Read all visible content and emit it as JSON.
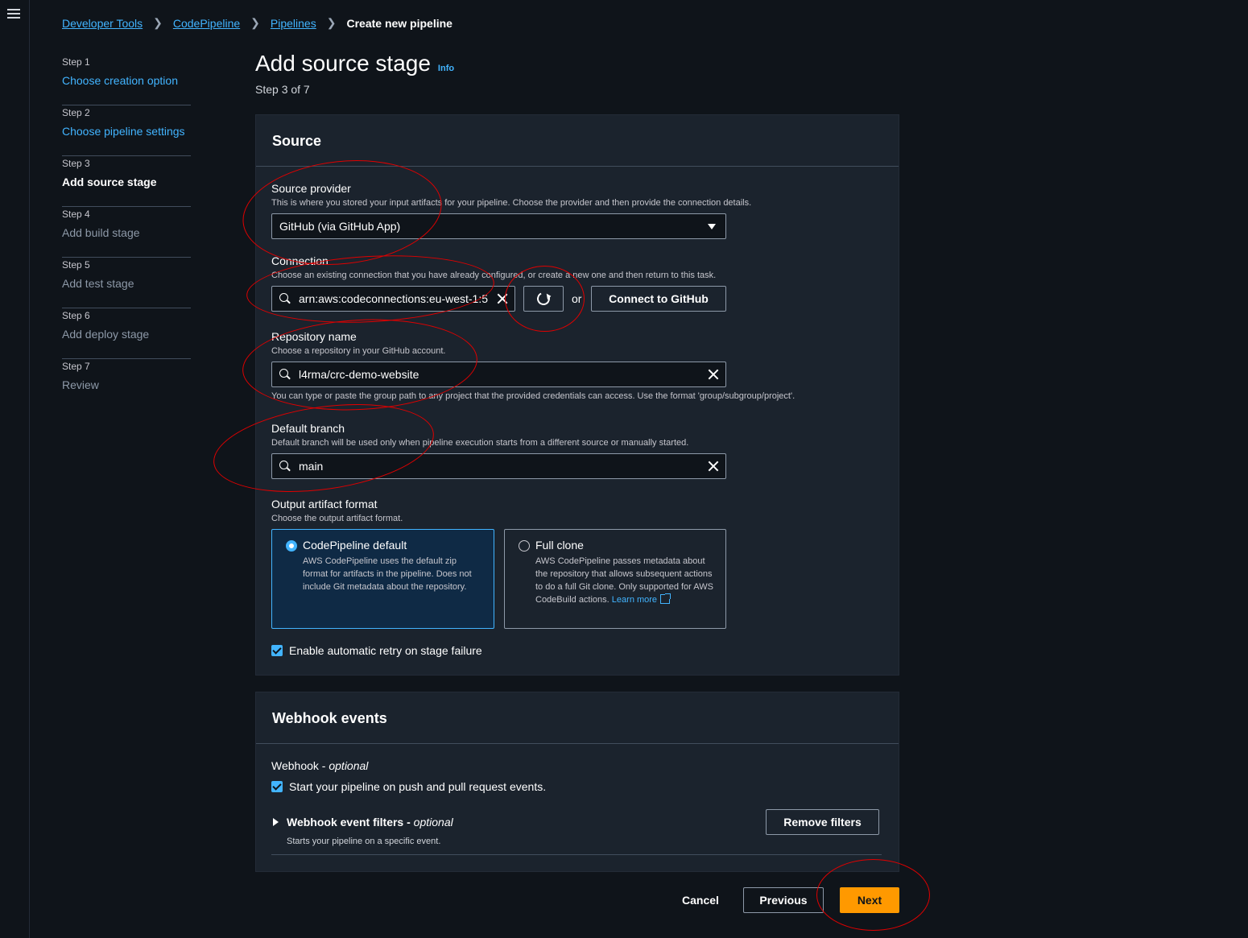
{
  "breadcrumbs": [
    "Developer Tools",
    "CodePipeline",
    "Pipelines"
  ],
  "breadcrumb_current": "Create new pipeline",
  "steps": [
    {
      "num": "Step 1",
      "title": "Choose creation option"
    },
    {
      "num": "Step 2",
      "title": "Choose pipeline settings"
    },
    {
      "num": "Step 3",
      "title": "Add source stage"
    },
    {
      "num": "Step 4",
      "title": "Add build stage"
    },
    {
      "num": "Step 5",
      "title": "Add test stage"
    },
    {
      "num": "Step 6",
      "title": "Add deploy stage"
    },
    {
      "num": "Step 7",
      "title": "Review"
    }
  ],
  "page": {
    "title": "Add source stage",
    "info": "Info",
    "step_of": "Step 3 of 7"
  },
  "source": {
    "heading": "Source",
    "provider_label": "Source provider",
    "provider_desc": "This is where you stored your input artifacts for your pipeline. Choose the provider and then provide the connection details.",
    "provider_value": "GitHub (via GitHub App)",
    "connection_label": "Connection",
    "connection_desc": "Choose an existing connection that you have already configured, or create a new one and then return to this task.",
    "connection_value": "arn:aws:codeconnections:eu-west-1:5",
    "or": "or",
    "connect_button": "Connect to GitHub",
    "repo_label": "Repository name",
    "repo_desc": "Choose a repository in your GitHub account.",
    "repo_value": "l4rma/crc-demo-website",
    "repo_hint": "You can type or paste the group path to any project that the provided credentials can access. Use the format 'group/subgroup/project'.",
    "branch_label": "Default branch",
    "branch_desc": "Default branch will be used only when pipeline execution starts from a different source or manually started.",
    "branch_value": "main",
    "artifact_label": "Output artifact format",
    "artifact_desc": "Choose the output artifact format.",
    "option_default_title": "CodePipeline default",
    "option_default_desc": "AWS CodePipeline uses the default zip format for artifacts in the pipeline. Does not include Git metadata about the repository.",
    "option_clone_title": "Full clone",
    "option_clone_desc": "AWS CodePipeline passes metadata about the repository that allows subsequent actions to do a full Git clone. Only supported for AWS CodeBuild actions.",
    "learn_more": "Learn more",
    "retry_label": "Enable automatic retry on stage failure"
  },
  "webhook": {
    "heading": "Webhook events",
    "label": "Webhook",
    "optional": "optional",
    "dash": " - ",
    "start_label": "Start your pipeline on push and pull request events.",
    "filters_title": "Webhook event filters",
    "filters_desc": "Starts your pipeline on a specific event.",
    "remove_filters": "Remove filters"
  },
  "footer": {
    "cancel": "Cancel",
    "previous": "Previous",
    "next": "Next"
  },
  "colors": {
    "accent": "#42b4ff",
    "primary_button": "#ff9900",
    "annotation": "#e00000"
  }
}
